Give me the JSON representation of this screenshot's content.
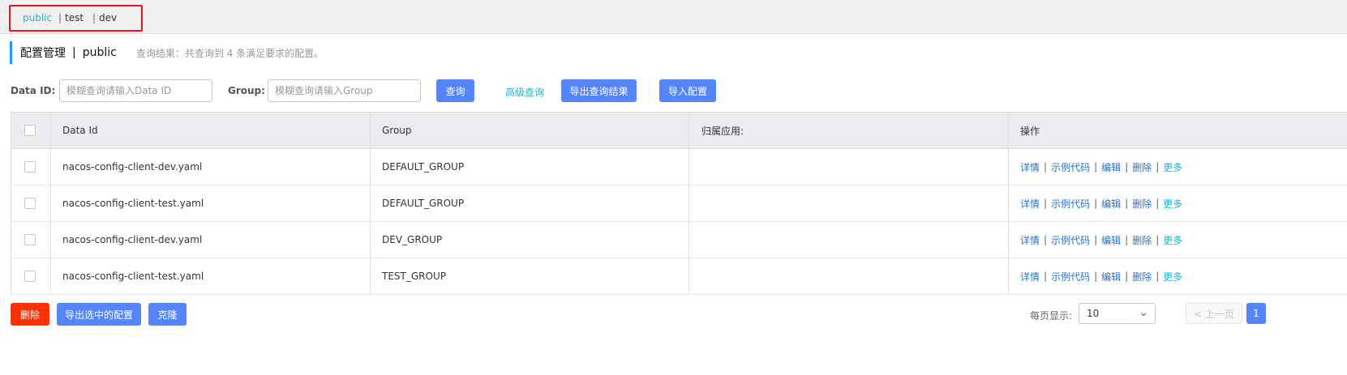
{
  "namespaces": {
    "items": [
      "public",
      "test",
      "dev"
    ],
    "active": "public",
    "separator": "|"
  },
  "title": {
    "main": "配置管理",
    "separator": "|",
    "namespace": "public",
    "result": "查询结果：共查询到 4 条满足要求的配置。"
  },
  "filters": {
    "data_id_label": "Data ID:",
    "data_id_placeholder": "模糊查询请输入Data ID",
    "group_label": "Group:",
    "group_placeholder": "模糊查询请输入Group",
    "query_button": "查询",
    "advanced_link": "高级查询",
    "export_button": "导出查询结果",
    "import_button": "导入配置"
  },
  "table": {
    "headers": [
      "Data Id",
      "Group",
      "归属应用:",
      "操作"
    ],
    "rows": [
      {
        "data_id": "nacos-config-client-dev.yaml",
        "group": "DEFAULT_GROUP",
        "app": ""
      },
      {
        "data_id": "nacos-config-client-test.yaml",
        "group": "DEFAULT_GROUP",
        "app": ""
      },
      {
        "data_id": "nacos-config-client-dev.yaml",
        "group": "DEV_GROUP",
        "app": ""
      },
      {
        "data_id": "nacos-config-client-test.yaml",
        "group": "TEST_GROUP",
        "app": ""
      }
    ],
    "actions": {
      "detail": "详情",
      "sample_code": "示例代码",
      "edit": "编辑",
      "delete": "删除",
      "more": "更多",
      "separator": "|"
    }
  },
  "footer": {
    "delete_button": "删除",
    "export_selected_button": "导出选中的配置",
    "clone_button": "克隆",
    "page_size_label": "每页显示:",
    "page_size_value": "10",
    "prev_page": "< 上一页",
    "current_page": "1"
  },
  "colors": {
    "primary": "#5584ff",
    "danger": "#ff3000",
    "link": "#2a72c9",
    "accent_link": "#1cb6d8",
    "highlight_box": "#e8141b",
    "title_accent": "#209bfa"
  }
}
